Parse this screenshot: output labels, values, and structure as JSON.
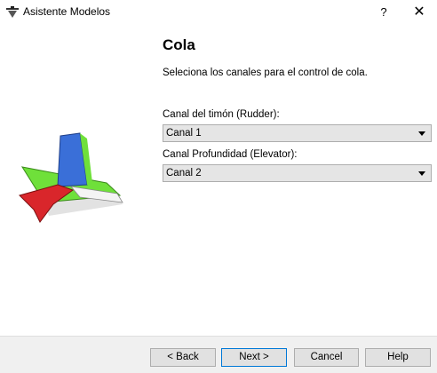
{
  "window": {
    "title": "Asistente Modelos",
    "help_symbol": "?",
    "close_symbol": "✕"
  },
  "page": {
    "title": "Cola",
    "subtitle": "Seleciona los canales para el control de cola."
  },
  "fields": {
    "rudder": {
      "label": "Canal del timón (Rudder):",
      "value": "Canal 1"
    },
    "elevator": {
      "label": "Canal Profundidad (Elevator):",
      "value": "Canal 2"
    }
  },
  "buttons": {
    "back": "< Back",
    "next": "Next >",
    "cancel": "Cancel",
    "help": "Help"
  },
  "colors": {
    "fin_blue": "#3a6fd8",
    "wing_green": "#6fe03a",
    "stab_red": "#d9262b",
    "next_border": "#0078d7"
  },
  "icons": {
    "app": "airplane-app-icon",
    "illustration": "airplane-tail-illustration"
  }
}
